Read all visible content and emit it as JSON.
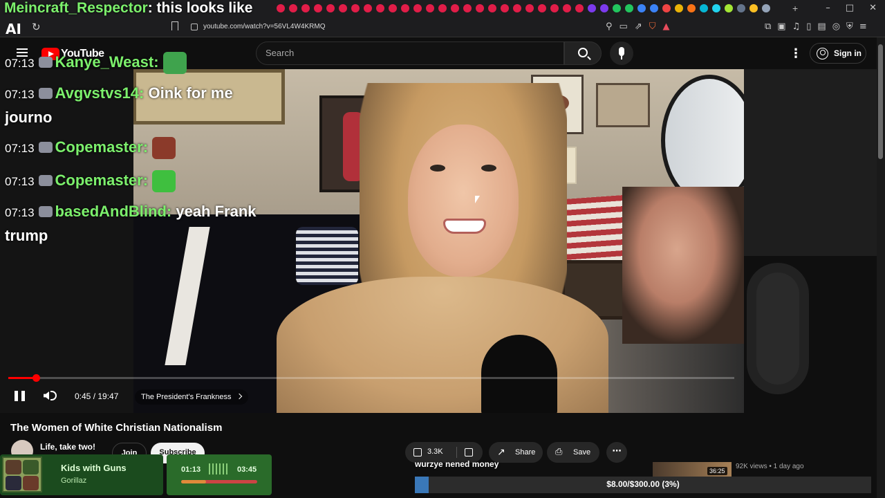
{
  "browser": {
    "url": "youtube.com/watch?v=56VL4W4KRMQ",
    "tab_icon_colors": [
      "#e11d48",
      "#e11d48",
      "#e11d48",
      "#e11d48",
      "#e11d48",
      "#e11d48",
      "#e11d48",
      "#e11d48",
      "#e11d48",
      "#e11d48",
      "#e11d48",
      "#e11d48",
      "#e11d48",
      "#e11d48",
      "#e11d48",
      "#e11d48",
      "#e11d48",
      "#e11d48",
      "#e11d48",
      "#e11d48",
      "#e11d48",
      "#e11d48",
      "#e11d48",
      "#e11d48",
      "#e11d48",
      "#7c3aed",
      "#7c3aed",
      "#22c55e",
      "#22c55e",
      "#3b82f6",
      "#3b82f6",
      "#ef4444",
      "#eab308",
      "#f97316",
      "#06b6d4",
      "#22d3ee",
      "#a3e635",
      "#64748b",
      "#fbbf24",
      "#94a3b8"
    ]
  },
  "youtube": {
    "logo_text": "YouTube",
    "search_placeholder": "Search",
    "sign_in_label": "Sign in"
  },
  "stream_chat": {
    "top_message": {
      "user": "Meincraft_Respector",
      "text": ": this looks like"
    },
    "lines": [
      {
        "time": "07:13",
        "user": "Kanye_Weast:",
        "text": "",
        "emote": "#3fa34d"
      },
      {
        "time": "07:13",
        "user": "Avgvstvs14:",
        "text": "Oink for me journo",
        "emote": ""
      },
      {
        "time": "07:13",
        "user": "Copemaster:",
        "text": "",
        "emote": "#8b3a2a"
      },
      {
        "time": "07:13",
        "user": "Copemaster:",
        "text": "",
        "emote": "#3fbf3f"
      },
      {
        "time": "07:13",
        "user": "basedAndBlind:",
        "text": "yeah Frank trump",
        "emote": ""
      }
    ]
  },
  "player": {
    "current_time": "0:45",
    "duration": "19:47",
    "time_display": "0:45 / 19:47",
    "progress_fraction": 0.038,
    "chapter": "The President's Frankness"
  },
  "video": {
    "title": "The Women of White Christian Nationalism",
    "channel_name": "Life, take two!",
    "join_label": "Join",
    "subscribe_label": "Subscribe",
    "likes": "3.3K",
    "share_label": "Share",
    "save_label": "Save"
  },
  "recommendation": {
    "duration": "36:25",
    "meta": "92K views • 1 day ago"
  },
  "overlay": {
    "message": "wurzye nened money",
    "song_title": "Kids with Guns",
    "song_artist": "Gorillaz",
    "song_elapsed": "01:13",
    "song_total": "03:45",
    "song_progress_fraction": 0.324,
    "goal_text": "$8.00/$300.00 (3%)",
    "goal_fraction": 0.03
  }
}
